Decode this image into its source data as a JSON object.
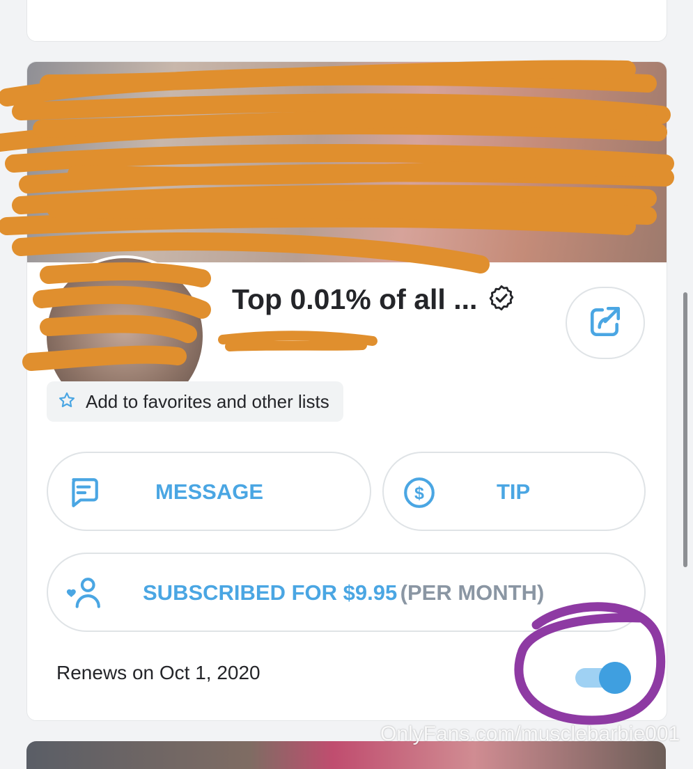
{
  "profile": {
    "display_name": "Top 0.01% of all ...",
    "verified_icon": "verified-badge-icon"
  },
  "favorites": {
    "label": "Add to favorites and other lists",
    "icon": "star-outline-icon"
  },
  "actions": {
    "message_label": "MESSAGE",
    "tip_label": "TIP"
  },
  "subscription": {
    "label": "SUBSCRIBED FOR $9.95",
    "period": "(PER MONTH)",
    "renews": "Renews on Oct 1, 2020",
    "auto_renew_on": true
  },
  "watermark": "OnlyFans.com/musclebarbie001",
  "colors": {
    "accent": "#4aa6e3",
    "scribble": "#e08f2e",
    "annotation_circle": "#8e3aa3",
    "text_dark": "#242529",
    "muted": "#8a96a3"
  }
}
